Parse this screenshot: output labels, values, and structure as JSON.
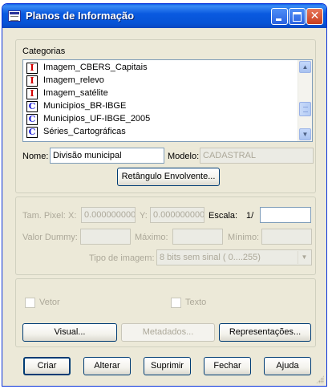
{
  "window": {
    "title": "Planos de Informação"
  },
  "categorias": {
    "label": "Categorias",
    "items": [
      {
        "label": "Imagem_CBERS_Capitais",
        "icon": "I"
      },
      {
        "label": "Imagem_relevo",
        "icon": "I"
      },
      {
        "label": "Imagem_satélite",
        "icon": "I"
      },
      {
        "label": "Municipios_BR-IBGE",
        "icon": "C"
      },
      {
        "label": "Municipios_UF-IBGE_2005",
        "icon": "C"
      },
      {
        "label": "Séries_Cartográficas",
        "icon": "C"
      }
    ]
  },
  "form": {
    "nome_label": "Nome:",
    "nome_value": "Divisão municipal",
    "modelo_label": "Modelo:",
    "modelo_value": "CADASTRAL",
    "retangulo_button": "Retângulo Envolvente..."
  },
  "image_params": {
    "tam_pixel_label": "Tam. Pixel:",
    "x_label": "X:",
    "x_value": "0.000000000",
    "y_label": "Y:",
    "y_value": "0.000000000",
    "escala_label": "Escala:",
    "escala_prefix": "1/",
    "escala_value": "",
    "valor_dummy_label": "Valor Dummy:",
    "valor_dummy_value": "",
    "maximo_label": "Máximo:",
    "maximo_value": "",
    "minimo_label": "Mínimo:",
    "minimo_value": "",
    "tipo_imagem_label": "Tipo de imagem:",
    "tipo_imagem_value": "8 bits sem sinal ( 0....255)"
  },
  "representation": {
    "vetor_label": "Vetor",
    "texto_label": "Texto",
    "visual_button": "Visual...",
    "metadados_button": "Metadados...",
    "representacoes_button": "Representações..."
  },
  "footer": {
    "criar": "Criar",
    "alterar": "Alterar",
    "suprimir": "Suprimir",
    "fechar": "Fechar",
    "ajuda": "Ajuda"
  }
}
